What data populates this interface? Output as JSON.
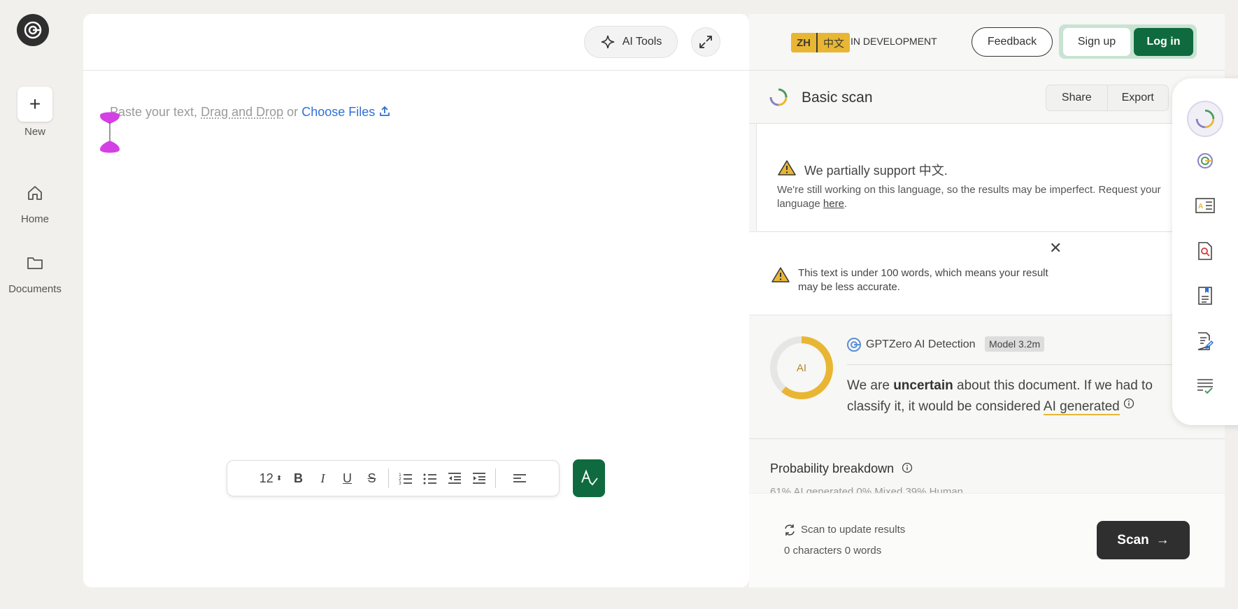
{
  "nav": {
    "new_label": "New",
    "home_label": "Home",
    "documents_label": "Documents"
  },
  "editor": {
    "ai_tools_label": "AI Tools",
    "placeholder_prefix": "Paste your text,",
    "placeholder_dragdrop": "Drag and Drop",
    "placeholder_or": "or",
    "placeholder_choose": "Choose Files",
    "font_size": "12"
  },
  "header": {
    "lang_code": "ZH",
    "lang_native": "中文",
    "status": "IN DEVELOPMENT",
    "feedback_label": "Feedback",
    "signup_label": "Sign up",
    "login_label": "Log in"
  },
  "scan": {
    "title": "Basic scan",
    "share_label": "Share",
    "export_label": "Export"
  },
  "notices": {
    "lang_title": "We partially support 中文.",
    "lang_body_1": "We're still working on this language, so the results may be imperfect. Request your",
    "lang_body_2": "language",
    "lang_link": "here",
    "lang_end": ".",
    "short_text": "This text is under 100 words, which means your result may be less accurate."
  },
  "detection": {
    "ring_label": "AI",
    "source": "GPTZero AI Detection",
    "model": "Model 3.2m",
    "text_pre": "We are",
    "text_bold": "uncertain",
    "text_mid": "about this document. If we had to classify it, it would be considered",
    "text_class": "AI generated",
    "ai_fraction": 0.61
  },
  "probability": {
    "title": "Probability breakdown",
    "peek": "61% AI generated    0% Mixed    39% Human"
  },
  "footer": {
    "update_text": "Scan to update results",
    "counts": "0 characters 0 words",
    "scan_label": "Scan"
  },
  "colors": {
    "accent_green": "#0f6b3f",
    "accent_yellow": "#e9b634",
    "link_blue": "#2f6fd6"
  }
}
